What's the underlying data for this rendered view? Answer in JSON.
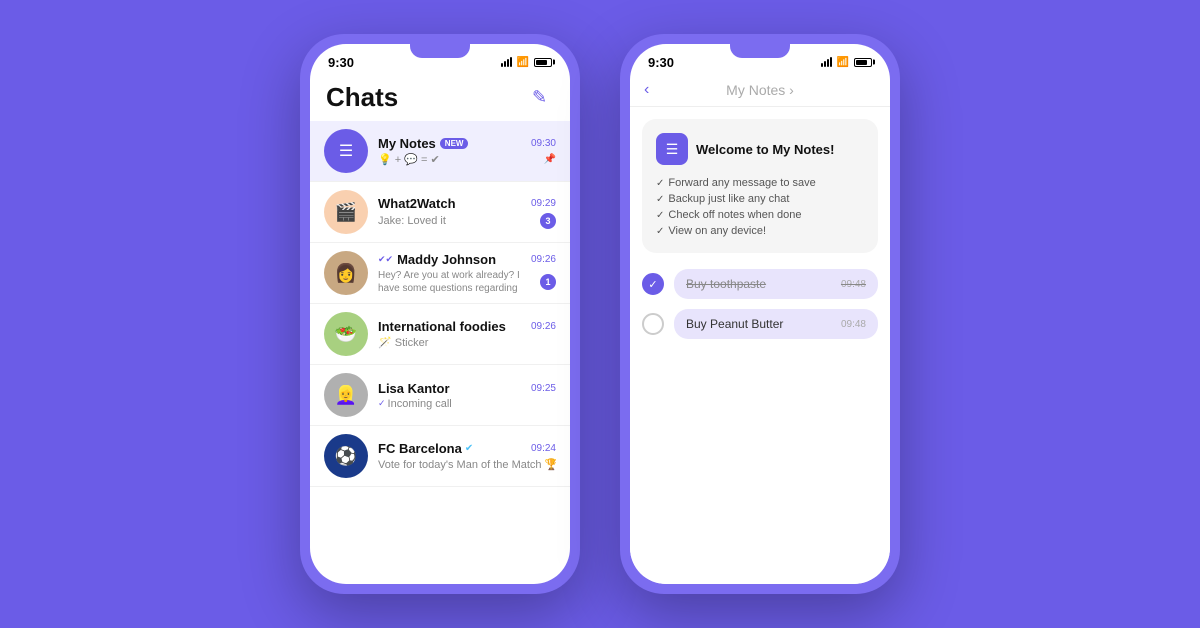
{
  "background_color": "#6B5CE7",
  "phone_left": {
    "status_bar": {
      "time": "9:30"
    },
    "header": {
      "title": "Chats",
      "compose_label": "✎"
    },
    "chats": [
      {
        "id": "my-notes",
        "name": "My Notes",
        "badge": "NEW",
        "time": "09:30",
        "preview": "💡 + 💬 = ✔",
        "avatar_type": "notes",
        "active": true,
        "pinned": true,
        "unread": null
      },
      {
        "id": "what2watch",
        "name": "What2Watch",
        "time": "09:29",
        "preview": "Jake: Loved it",
        "avatar_type": "w2w",
        "avatar_emoji": "🎬",
        "unread": 3
      },
      {
        "id": "maddy",
        "name": "Maddy Johnson",
        "time": "09:26",
        "preview": "Hey? Are you at work already? I have some questions regarding",
        "avatar_type": "maddy",
        "unread": 1,
        "double_check": true
      },
      {
        "id": "foodies",
        "name": "International foodies",
        "time": "09:26",
        "preview": "🪄 Sticker",
        "avatar_type": "food",
        "avatar_emoji": "🥗",
        "unread": null
      },
      {
        "id": "lisa",
        "name": "Lisa Kantor",
        "time": "09:25",
        "preview": "✓ Incoming call",
        "avatar_type": "lisa",
        "unread": null,
        "check": true
      },
      {
        "id": "fcb",
        "name": "FC Barcelona",
        "time": "09:24",
        "preview": "Vote for today's Man of the Match 🏆",
        "avatar_type": "fcb",
        "avatar_emoji": "⚽",
        "verified": true,
        "unread": null
      }
    ]
  },
  "phone_right": {
    "status_bar": {
      "time": "9:30"
    },
    "header": {
      "back_label": "‹",
      "title": "My Notes",
      "chevron": "›"
    },
    "welcome_card": {
      "title": "Welcome to My Notes!",
      "items": [
        "Forward any message to save",
        "Backup just like any chat",
        "Check off notes when done",
        "View on any device!"
      ]
    },
    "todos": [
      {
        "text": "Buy toothpaste",
        "time": "09:48",
        "checked": true
      },
      {
        "text": "Buy Peanut Butter",
        "time": "09:48",
        "checked": false
      }
    ]
  }
}
